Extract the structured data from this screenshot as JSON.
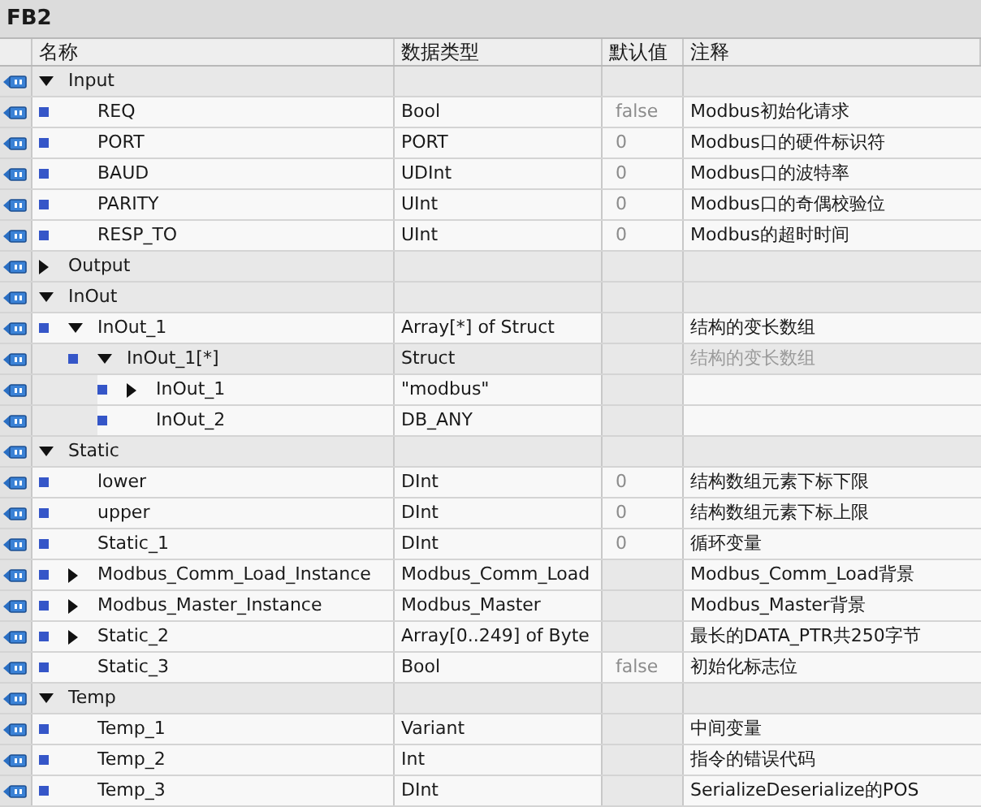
{
  "title": "FB2",
  "columns": [
    "名称",
    "数据类型",
    "默认值",
    "注释"
  ],
  "sections": [
    {
      "name": "Input",
      "expanded": true,
      "children": [
        {
          "name": "REQ",
          "type": "Bool",
          "default": "false",
          "comment": "Modbus初始化请求"
        },
        {
          "name": "PORT",
          "type": "PORT",
          "default": "0",
          "comment": "Modbus口的硬件标识符"
        },
        {
          "name": "BAUD",
          "type": "UDInt",
          "default": "0",
          "comment": "Modbus口的波特率"
        },
        {
          "name": "PARITY",
          "type": "UInt",
          "default": "0",
          "comment": "Modbus口的奇偶校验位"
        },
        {
          "name": "RESP_TO",
          "type": "UInt",
          "default": "0",
          "comment": "Modbus的超时时间"
        }
      ]
    },
    {
      "name": "Output",
      "expanded": false
    },
    {
      "name": "InOut",
      "expanded": true,
      "children": [
        {
          "name": "InOut_1",
          "type": "Array[*] of Struct",
          "comment": "结构的变长数组",
          "expanded": true,
          "children": [
            {
              "name": "InOut_1[*]",
              "type": "Struct",
              "comment": "结构的变长数组",
              "inherited": true,
              "expanded": true,
              "children": [
                {
                  "name": "InOut_1",
                  "type": "\"modbus\"",
                  "expanded": false
                },
                {
                  "name": "InOut_2",
                  "type": "DB_ANY"
                }
              ]
            }
          ]
        }
      ]
    },
    {
      "name": "Static",
      "expanded": true,
      "children": [
        {
          "name": "lower",
          "type": "DInt",
          "default": "0",
          "comment": "结构数组元素下标下限"
        },
        {
          "name": "upper",
          "type": "DInt",
          "default": "0",
          "comment": "结构数组元素下标上限"
        },
        {
          "name": "Static_1",
          "type": "DInt",
          "default": "0",
          "comment": "循环变量"
        },
        {
          "name": "Modbus_Comm_Load_Instance",
          "type": "Modbus_Comm_Load",
          "comment": "Modbus_Comm_Load背景",
          "expanded": false
        },
        {
          "name": "Modbus_Master_Instance",
          "type": "Modbus_Master",
          "comment": "Modbus_Master背景",
          "expanded": false
        },
        {
          "name": "Static_2",
          "type": "Array[0..249] of Byte",
          "comment": "最长的DATA_PTR共250字节",
          "expanded": false
        },
        {
          "name": "Static_3",
          "type": "Bool",
          "default": "false",
          "comment": "初始化标志位"
        }
      ]
    },
    {
      "name": "Temp",
      "expanded": true,
      "children": [
        {
          "name": "Temp_1",
          "type": "Variant",
          "comment": "中间变量"
        },
        {
          "name": "Temp_2",
          "type": "Int",
          "comment": "指令的错误代码"
        },
        {
          "name": "Temp_3",
          "type": "DInt",
          "comment": "SerializeDeserialize的POS"
        }
      ]
    }
  ]
}
